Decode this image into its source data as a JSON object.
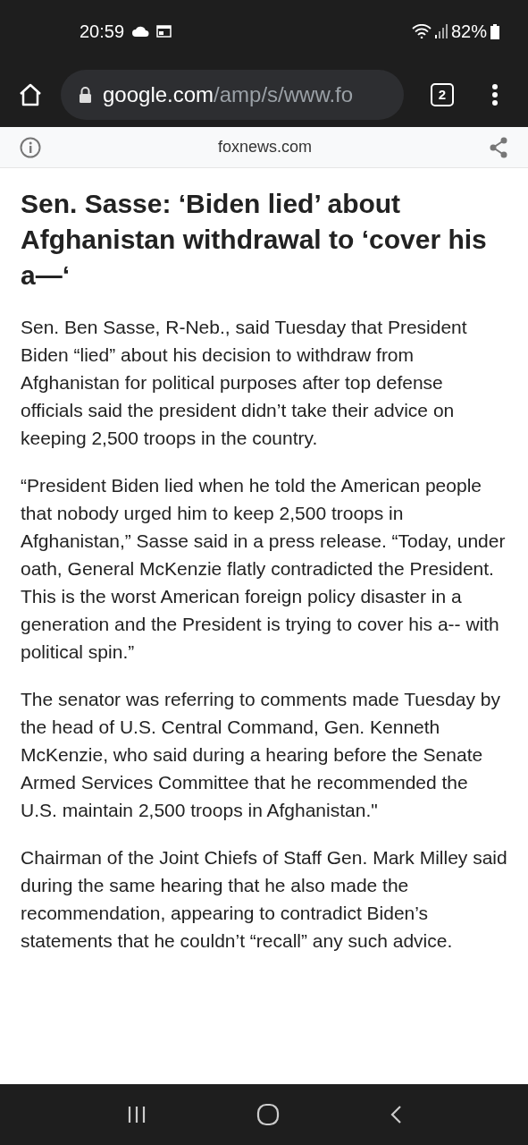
{
  "status_bar": {
    "time": "20:59",
    "battery": "82%"
  },
  "browser": {
    "url_host": "google.com",
    "url_path": "/amp/s/www.fo",
    "tab_count": "2"
  },
  "amp_bar": {
    "domain": "foxnews.com"
  },
  "article": {
    "headline": "Sen. Sasse: ‘Biden lied’ about Afghanistan withdrawal to ‘cover his a—‘",
    "paragraphs": [
      "Sen. Ben Sasse, R-Neb., said Tuesday that President Biden “lied” about his decision to withdraw from Afghanistan for political purposes after top defense officials said the president didn’t take their advice on keeping 2,500 troops in the country.",
      "“President Biden lied when he told the American people that nobody urged him to keep 2,500 troops in Afghanistan,” Sasse said in a press release. “Today, under oath, General McKenzie flatly contradicted the President. This is the worst American foreign policy disaster in a generation and the President is trying to cover his a-- with political spin.”",
      "The senator was referring to comments made Tuesday by the head of U.S. Central Command, Gen. Kenneth McKenzie, who said during a hearing before the Senate Armed Services Committee that he recommended the U.S. maintain 2,500 troops in Afghanistan.\"",
      "Chairman of the Joint Chiefs of Staff Gen. Mark Milley said during the same hearing that he also made the recommendation, appearing to contradict Biden’s statements that he couldn’t “recall” any such advice."
    ]
  }
}
